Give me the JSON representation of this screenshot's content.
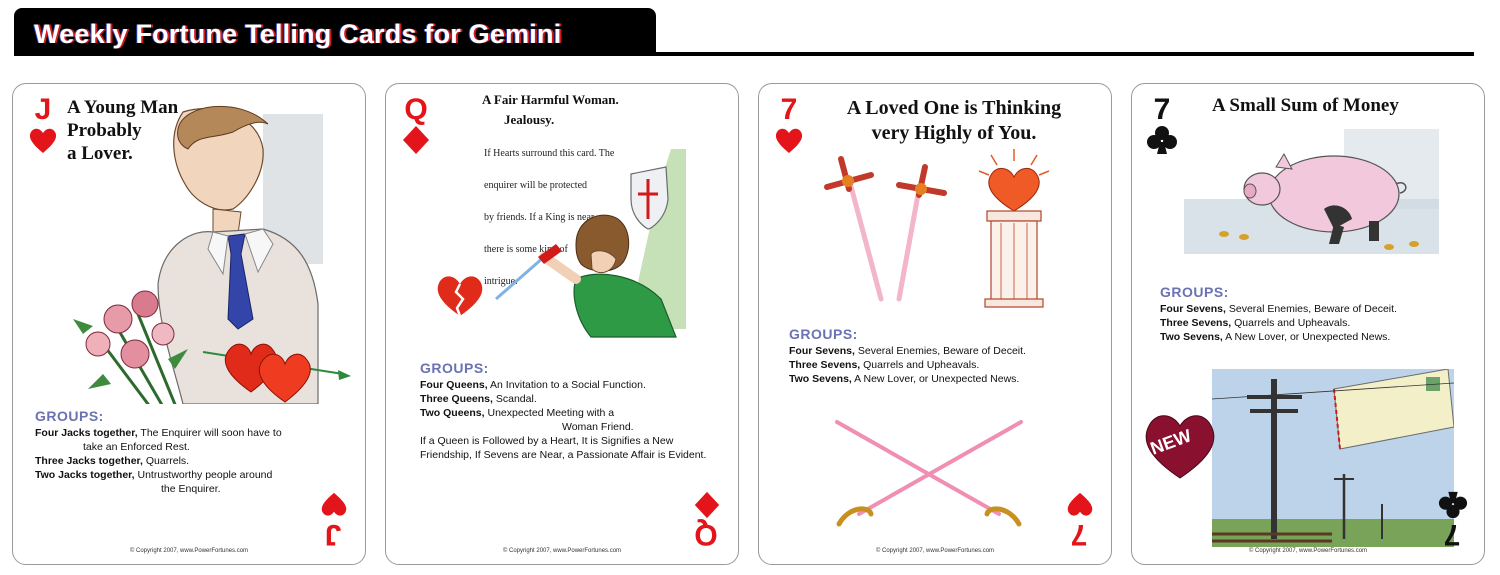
{
  "header": {
    "title": "Weekly Fortune Telling Cards for Gemini"
  },
  "colors": {
    "red": "#e4151a",
    "black": "#111111",
    "groups_heading": "#6b72b3"
  },
  "cards": [
    {
      "rank": "J",
      "suit": "heart",
      "title_lines": [
        "A Young Man",
        "Probably",
        "a Lover."
      ],
      "groups_heading": "GROUPS:",
      "groups": [
        {
          "bold": "Four Jacks together,",
          "text": " The Enquirer will soon have to",
          "cont": "take an Enforced Rest."
        },
        {
          "bold": "Three Jacks together,",
          "text": " Quarrels."
        },
        {
          "bold": "Two Jacks together,",
          "text": " Untrustworthy people around",
          "cont": "the Enquirer."
        }
      ],
      "copyright": "© Copyright 2007, www.PowerFortunes.com"
    },
    {
      "rank": "Q",
      "suit": "diamond",
      "title_lines": [
        "A Fair Harmful Woman."
      ],
      "subtitle": "Jealousy.",
      "note_lines": [
        "If Hearts surround this card. The",
        "enquirer will be protected",
        "by friends. If a King is near,",
        "there is some kind of",
        "intrigue."
      ],
      "groups_heading": "GROUPS:",
      "groups": [
        {
          "bold": "Four Queens,",
          "text": " An Invitation to a Social Function."
        },
        {
          "bold": "Three Queens,",
          "text": " Scandal."
        },
        {
          "bold": "Two Queens,",
          "text": " Unexpected Meeting with a",
          "cont": "Woman Friend."
        }
      ],
      "extra": "If a Queen is Followed by a Heart, It is Signifies a New Friendship, If Sevens are Near, a Passionate Affair is Evident.",
      "copyright": "© Copyright 2007, www.PowerFortunes.com"
    },
    {
      "rank": "7",
      "suit": "heart",
      "title_lines": [
        "A Loved One is Thinking",
        "very Highly of You."
      ],
      "groups_heading": "GROUPS:",
      "groups": [
        {
          "bold": "Four Sevens,",
          "text": " Several Enemies, Beware of Deceit."
        },
        {
          "bold": "Three Sevens,",
          "text": " Quarrels and Upheavals."
        },
        {
          "bold": "Two Sevens,",
          "text": " A New Lover, or Unexpected News."
        }
      ],
      "copyright": "© Copyright 2007, www.PowerFortunes.com"
    },
    {
      "rank": "7",
      "suit": "club",
      "title_lines": [
        "A Small Sum of Money"
      ],
      "groups_heading": "GROUPS:",
      "groups": [
        {
          "bold": "Four Sevens,",
          "text": " Several Enemies, Beware of Deceit."
        },
        {
          "bold": "Three Sevens,",
          "text": " Quarrels and Upheavals."
        },
        {
          "bold": "Two Sevens,",
          "text": " A New Lover, or Unexpected News."
        }
      ],
      "badge": "NEW",
      "copyright": "© Copyright 2007, www.PowerFortunes.com"
    }
  ]
}
